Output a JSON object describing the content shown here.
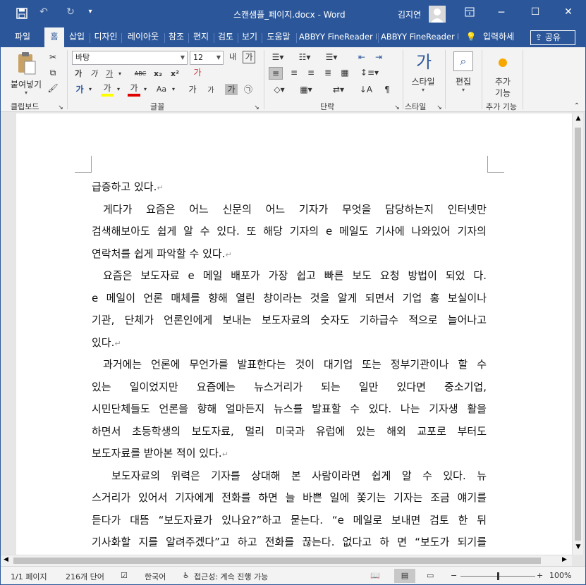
{
  "titlebar": {
    "title": "스캔샘플_페이지.docx  -  Word",
    "user": "김지연",
    "save_icon": "save-icon",
    "undo_icon": "undo-icon",
    "redo_icon": "redo-icon",
    "qat_more": "▾",
    "ribbon_display": "ribbon-display-icon",
    "minimize": "─",
    "maximize": "☐",
    "close": "✕"
  },
  "tabs": [
    "파일",
    "홈",
    "삽입",
    "디자인",
    "레이아웃",
    "참조",
    "편지",
    "검토",
    "보기",
    "도움말",
    "ABBYY FineReader F",
    "ABBYY FineReader F"
  ],
  "tell_me": "입력하세",
  "share": "공유",
  "ribbon": {
    "paste_label": "붙여넣기",
    "clipboard": "클립보드",
    "font_name": "바탕",
    "font_size": "12",
    "font_group": "글꼴",
    "paragraph_group": "단락",
    "style_label": "스타일",
    "style_group": "스타일",
    "edit_label": "편집",
    "addin_label1": "추가",
    "addin_label2": "기능",
    "addin_group": "추가 기능",
    "bold": "가",
    "italic": "가",
    "underline": "가",
    "strike": "ABC",
    "subscript": "x₂",
    "superscript": "x²",
    "style_big": "가",
    "font_color": "가",
    "highlight": "가",
    "case": "Aa",
    "grow": "가",
    "shrink": "가",
    "clear": "가",
    "phonetic": "내",
    "charbox": "가",
    "enclosed": "㉠",
    "text_effects": "가"
  },
  "document": {
    "lines": [
      {
        "text": "급증하고 있다.",
        "mark": "↵",
        "indent": 0
      },
      {
        "text": "게다가 요즘은 어느 신문의 어느 기자가 무엇을 담당하는지 인터넷만",
        "mark": "",
        "indent": 1
      },
      {
        "text": "검색해보아도 쉽게 알 수 있다. 또 해당 기자의 e 메일도 기사에 나와있어 기자의",
        "mark": "",
        "indent": 0
      },
      {
        "text": "연락처를 쉽게 파악할 수 있다.",
        "mark": "↵",
        "indent": 0
      },
      {
        "text": "요즘은 보도자료 e 메일 배포가 가장 쉽고 빠른 보도 요청 방법이 되었 다.",
        "mark": "",
        "indent": 1
      },
      {
        "text": "e 메일이 언론 매체를 향해 열린 창이라는 것을 알게 되면서 기업 홍 보실이나",
        "mark": "",
        "indent": 0
      },
      {
        "text": "기관, 단체가 언론인에게 보내는 보도자료의 숫자도 기하급수 적으로 늘어나고",
        "mark": "",
        "indent": 0
      },
      {
        "text": "있다.",
        "mark": "↵",
        "indent": 0
      },
      {
        "text": "과거에는 언론에 무언가를 발표한다는 것이 대기업 또는 정부기관이나 할 수",
        "mark": "",
        "indent": 1
      },
      {
        "text": "있는 일이었지만 요즘에는 뉴스거리가 되는 일만 있다면 중소기업,",
        "mark": "",
        "indent": 0
      },
      {
        "text": "시민단체들도 언론을 향해 얼마든지 뉴스를 발표할 수 있다. 나는 기자생 활을",
        "mark": "",
        "indent": 0
      },
      {
        "text": "하면서 초등학생의 보도자료, 멀리 미국과 유럽에 있는 해외 교포로 부터도",
        "mark": "",
        "indent": 0
      },
      {
        "text": "보도자료를 받아본 적이 있다.",
        "mark": "↵",
        "indent": 0
      },
      {
        "text": "보도자료의 위력은 기자를 상대해 본 사람이라면 쉽게 알 수 있다. 뉴",
        "mark": "",
        "indent": 2
      },
      {
        "text": "스거리가 있어서 기자에게 전화를 하면 늘 바쁜 일에 쫓기는 기자는 조금 얘기를",
        "mark": "",
        "indent": 0
      },
      {
        "text": "듣다가 대뜸 “보도자료가 있나요?”하고 묻는다. “e 메일로 보내면 검토 한 뒤",
        "mark": "",
        "indent": 0
      },
      {
        "text": "기사화할 지를 알려주겠다”고 하고 전화를 끊는다. 없다고 하 면 “보도가 되기를",
        "mark": "",
        "indent": 0
      }
    ]
  },
  "status": {
    "page": "1/1 페이지",
    "words": "216개 단어",
    "language": "한국어",
    "accessibility": "접근성: 계속 진행 가능",
    "zoom": "100%",
    "zoom_minus": "−",
    "zoom_plus": "+",
    "zoom_level": 0.5
  },
  "colors": {
    "brand": "#2b579a",
    "font_color_bar": "#e00000",
    "highlight_bar": "#ffff00"
  }
}
